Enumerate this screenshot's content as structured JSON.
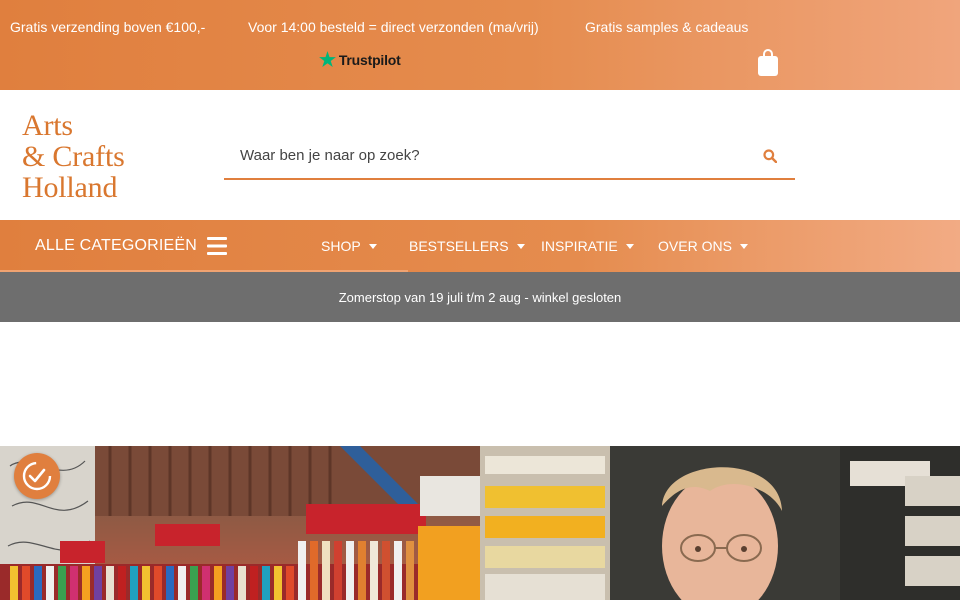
{
  "topbar": {
    "usps": [
      "Gratis verzending boven €100,-",
      "Voor 14:00 besteld = direct verzonden (ma/vrij)",
      "Gratis samples & cadeaus"
    ],
    "trustpilot_label": "Trustpilot",
    "trustpilot_icon": "star-icon",
    "cart_icon": "shopping-bag-icon"
  },
  "logo": {
    "lines": [
      "Arts",
      "& Crafts",
      "Holland"
    ]
  },
  "search": {
    "placeholder": "Waar ben je naar op zoek?",
    "icon": "search-icon"
  },
  "nav": {
    "all_categories_label": "ALLE CATEGORIEËN",
    "all_categories_icon": "hamburger-icon",
    "items": [
      {
        "label": "SHOP"
      },
      {
        "label": "BESTSELLERS"
      },
      {
        "label": "INSPIRATIE"
      },
      {
        "label": "OVER ONS"
      }
    ]
  },
  "notice": {
    "text": "Zomerstop van 19 juli t/m 2 aug - winkel gesloten"
  },
  "hero": {
    "left_image": "store-paint-shelves-photo",
    "right_image": "employee-portrait-photo",
    "badge_icon": "accessibility-check-icon"
  },
  "colors": {
    "brand_orange": "#e07f3e",
    "notice_gray": "#6e6e6e",
    "trustpilot_green": "#00b67a"
  }
}
